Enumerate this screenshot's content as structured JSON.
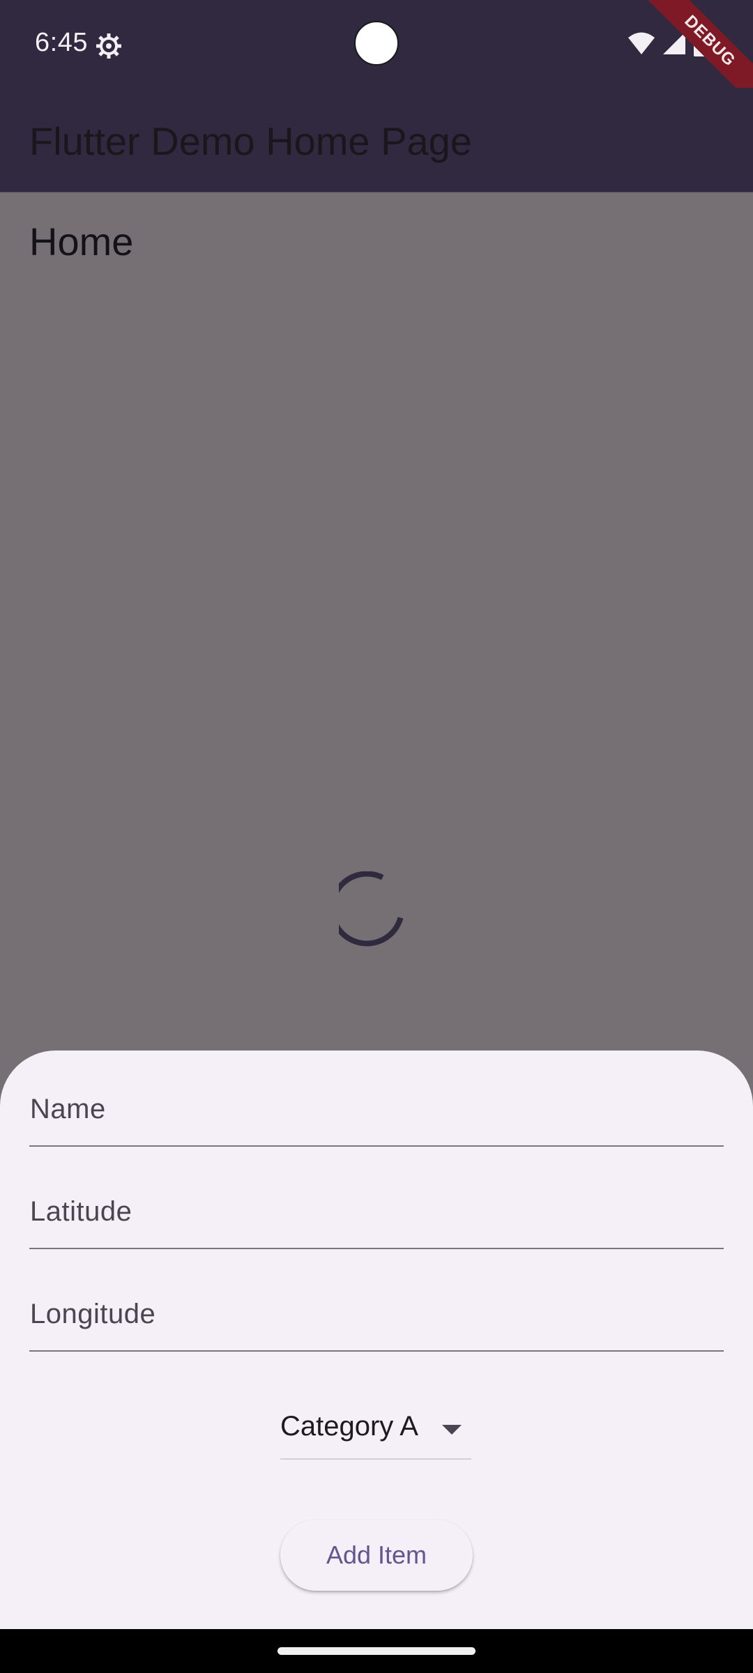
{
  "status_bar": {
    "time": "6:45",
    "icons": [
      "gear-icon",
      "wifi-icon",
      "signal-icon",
      "battery-icon"
    ]
  },
  "debug_banner": {
    "label": "DEBUG"
  },
  "app_bar": {
    "title": "Flutter Demo Home Page"
  },
  "page": {
    "heading": "Home",
    "loading": true
  },
  "sheet": {
    "fields": [
      {
        "placeholder": "Name",
        "value": ""
      },
      {
        "placeholder": "Latitude",
        "value": ""
      },
      {
        "placeholder": "Longitude",
        "value": ""
      }
    ],
    "category": {
      "selected": "Category A"
    },
    "add_button_label": "Add Item"
  },
  "colors": {
    "app_bar": "#30293f",
    "scrim_background": "#767074",
    "sheet_background": "#f5eff7",
    "button_text": "#65558f",
    "debug_ribbon": "#7e1a25"
  }
}
